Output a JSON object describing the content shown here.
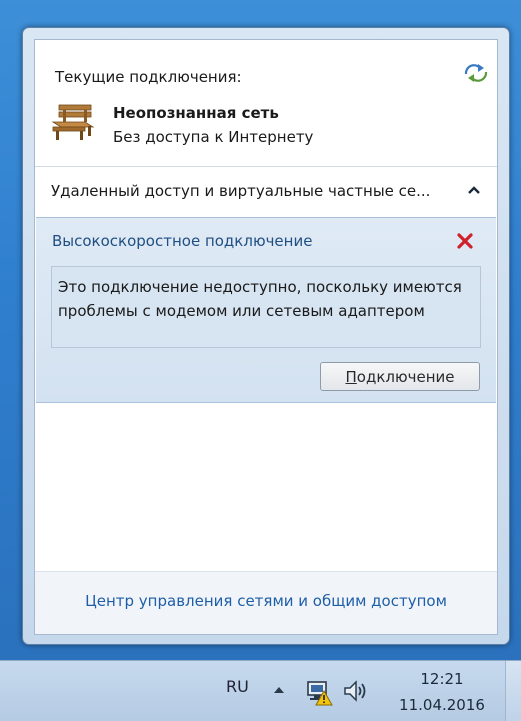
{
  "popup": {
    "current_connections_label": "Текущие подключения:",
    "network": {
      "name": "Неопознанная сеть",
      "status": "Без доступа к Интернету",
      "icon": "bench-network-icon"
    },
    "vpn_section": {
      "label": "Удаленный доступ и виртуальные частные се...",
      "state": "expanded"
    },
    "connection": {
      "title": "Высокоскоростное подключение",
      "error_message": "Это подключение недоступно, поскольку имеются проблемы с модемом или сетевым адаптером",
      "connect_label_prefix": "",
      "connect_label_accel": "П",
      "connect_label_rest": "одключение"
    },
    "footer_link": "Центр управления сетями и общим доступом"
  },
  "taskbar": {
    "language": "RU",
    "time": "12:21",
    "date": "11.04.2016"
  },
  "colors": {
    "link": "#1f5ea8",
    "connection_title": "#1f4f82",
    "close_red": "#d0202a"
  }
}
